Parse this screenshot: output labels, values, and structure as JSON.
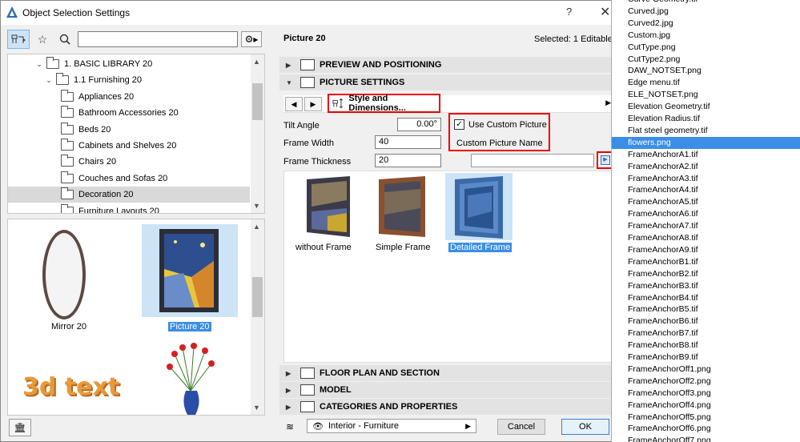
{
  "window": {
    "title": "Object Selection Settings",
    "help": "?",
    "close": "✕"
  },
  "search": {
    "placeholder": ""
  },
  "tree": [
    {
      "label": "1. BASIC LIBRARY 20",
      "level": 1,
      "expanded": true
    },
    {
      "label": "1.1 Furnishing 20",
      "level": 2,
      "expanded": true
    },
    {
      "label": "Appliances 20",
      "level": 3
    },
    {
      "label": "Bathroom Accessories 20",
      "level": 3
    },
    {
      "label": "Beds 20",
      "level": 3
    },
    {
      "label": "Cabinets and Shelves 20",
      "level": 3
    },
    {
      "label": "Chairs 20",
      "level": 3
    },
    {
      "label": "Couches and Sofas 20",
      "level": 3
    },
    {
      "label": "Decoration 20",
      "level": 3,
      "selected": true
    },
    {
      "label": "Furniture Layouts 20",
      "level": 3
    }
  ],
  "thumbnails": [
    {
      "label": "Mirror 20",
      "selected": false
    },
    {
      "label": "Picture 20",
      "selected": true
    }
  ],
  "thumb_text_3d": "3d text",
  "right": {
    "name": "Picture 20",
    "selected_info": "Selected: 1 Editable:",
    "sections": {
      "preview": "PREVIEW AND POSITIONING",
      "picture": "PICTURE SETTINGS",
      "floorplan": "FLOOR PLAN AND SECTION",
      "model": "MODEL",
      "categories": "CATEGORIES AND PROPERTIES"
    },
    "style_button": "Style and Dimensions...",
    "fields": {
      "tilt_angle_label": "Tilt Angle",
      "tilt_angle_value": "0.00°",
      "frame_width_label": "Frame Width",
      "frame_width_value": "40",
      "frame_thickness_label": "Frame Thickness",
      "frame_thickness_value": "20"
    },
    "custom": {
      "use_custom_label": "Use Custom Picture",
      "use_custom_checked": true,
      "name_label": "Custom Picture Name"
    },
    "frames": [
      {
        "label": "without Frame",
        "selected": false
      },
      {
        "label": "Simple Frame",
        "selected": false
      },
      {
        "label": "Detailed Frame",
        "selected": true
      }
    ],
    "layer": "Interior - Furniture",
    "cancel": "Cancel",
    "ok": "OK"
  },
  "files": [
    "Curve Geometry.tif",
    "Curved.jpg",
    "Curved2.jpg",
    "Custom.jpg",
    "CutType.png",
    "CutType2.png",
    "DAW_NOTSET.png",
    "Edge menu.tif",
    "ELE_NOTSET.png",
    "Elevation Geometry.tif",
    "Elevation Radius.tif",
    "Flat steel geometry.tif",
    "flowers.png",
    "FrameAnchorA1.tif",
    "FrameAnchorA2.tif",
    "FrameAnchorA3.tif",
    "FrameAnchorA4.tif",
    "FrameAnchorA5.tif",
    "FrameAnchorA6.tif",
    "FrameAnchorA7.tif",
    "FrameAnchorA8.tif",
    "FrameAnchorA9.tif",
    "FrameAnchorB1.tif",
    "FrameAnchorB2.tif",
    "FrameAnchorB3.tif",
    "FrameAnchorB4.tif",
    "FrameAnchorB5.tif",
    "FrameAnchorB6.tif",
    "FrameAnchorB7.tif",
    "FrameAnchorB8.tif",
    "FrameAnchorB9.tif",
    "FrameAnchorOff1.png",
    "FrameAnchorOff2.png",
    "FrameAnchorOff3.png",
    "FrameAnchorOff4.png",
    "FrameAnchorOff5.png",
    "FrameAnchorOff6.png",
    "FrameAnchorOff7.png"
  ],
  "selected_file": "flowers.png",
  "colors": {
    "selection": "#3a8ee6",
    "highlight_box": "#e00000"
  }
}
